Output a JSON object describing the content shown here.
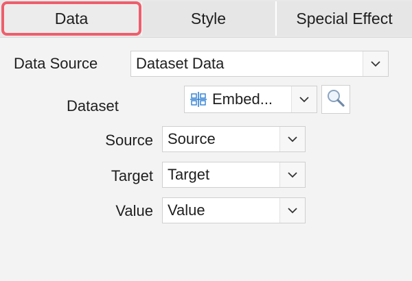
{
  "tabs": [
    {
      "label": "Data"
    },
    {
      "label": "Style"
    },
    {
      "label": "Special Effect"
    }
  ],
  "form": {
    "data_source": {
      "label": "Data Source",
      "value": "Dataset Data"
    },
    "dataset": {
      "label": "Dataset",
      "value": "Embed..."
    },
    "source": {
      "label": "Source",
      "value": "Source"
    },
    "target": {
      "label": "Target",
      "value": "Target"
    },
    "value": {
      "label": "Value",
      "value": "Value"
    }
  },
  "colors": {
    "active_tab_border": "#ee5e6c",
    "icon_blue": "#2f7fd3"
  },
  "icons": {
    "dataset_icon": "embedded-table-icon",
    "search_icon": "magnifier-icon",
    "dropdown_icon": "chevron-down-icon"
  }
}
